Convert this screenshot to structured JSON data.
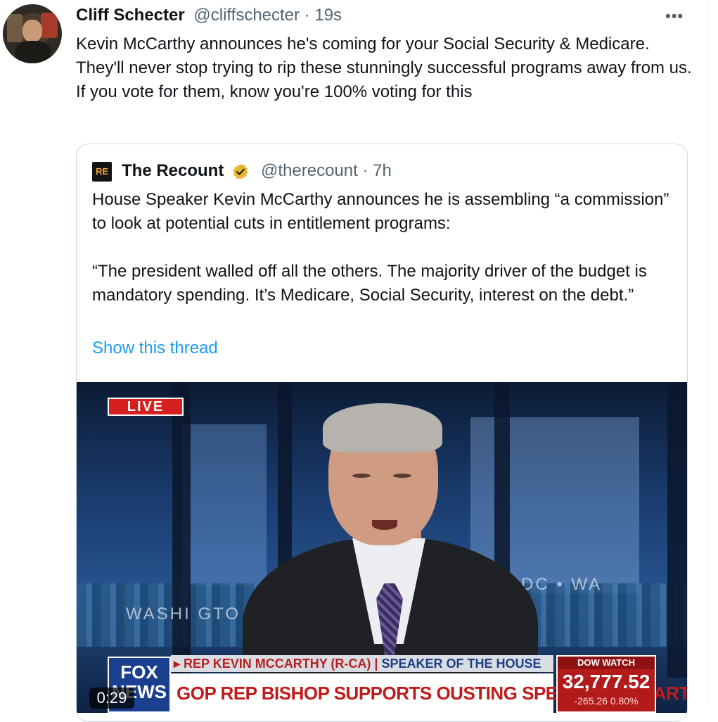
{
  "tweet": {
    "author_name": "Cliff Schecter",
    "author_handle": "@cliffschecter",
    "time_sep": " · ",
    "time_ago": "19s",
    "more_icon": "•••",
    "text": "Kevin McCarthy announces he's coming for your Social Security & Medicare. They'll never stop trying to rip these stunningly successful programs away from us. If you vote for them, know you're 100% voting for this"
  },
  "quote": {
    "logo_text": "RE",
    "name": "The Recount",
    "verified_icon": "gold-verified-badge-icon",
    "handle": "@therecount",
    "time_sep": " · ",
    "time_ago": "7h",
    "paragraph_1": "House Speaker Kevin McCarthy announces he is assembling “a commission” to look at potential cuts in entitlement programs:",
    "paragraph_2": "“The president walled off all the others. The majority driver of the budget is mandatory spending. It’s Medicare, Social Security, interest on the debt.”",
    "show_thread": "Show this thread"
  },
  "video": {
    "live_label": "LIVE",
    "wall_left": "WASHI  GTO",
    "wall_right": "DC    •    WA",
    "chyron_top_left": "▸ REP KEVIN MCCARTHY (R-CA)",
    "chyron_top_sep": " | ",
    "chyron_top_right": "SPEAKER OF THE HOUSE",
    "chyron_main": "GOP REP BISHOP SUPPORTS OUSTING SPEAKER MCCARTHY",
    "network_line1": "FOX",
    "network_line2": "NEWS",
    "dow_title": "DOW WATCH",
    "dow_value": "32,777.52",
    "dow_change": "-265.26  0.80%",
    "timestamp": "0:29"
  },
  "colors": {
    "link": "#1d9bf0",
    "secondary_text": "#536471",
    "verified_gold": "#e8b730",
    "live_red": "#d6201f"
  }
}
